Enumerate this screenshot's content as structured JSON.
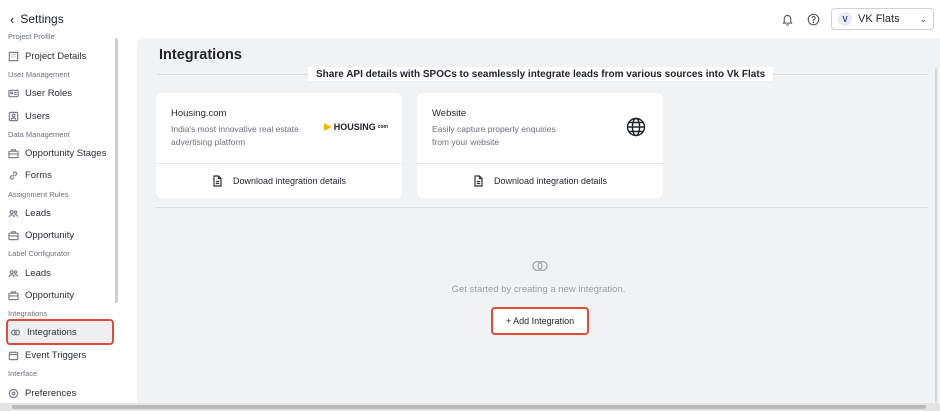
{
  "header": {
    "back_label": "Settings",
    "project_avatar": "V",
    "project_name": "VK Flats"
  },
  "sidebar": {
    "sections": [
      {
        "label": "Project Profile"
      },
      {
        "label": "User Management"
      },
      {
        "label": "Data Management"
      },
      {
        "label": "Assignment Rules"
      },
      {
        "label": "Label Configurator"
      },
      {
        "label": "Integrations"
      },
      {
        "label": "Interface"
      }
    ],
    "items": [
      {
        "label": "Project Details",
        "icon": "building-icon"
      },
      {
        "label": "User Roles",
        "icon": "id-card-icon"
      },
      {
        "label": "Users",
        "icon": "users-icon"
      },
      {
        "label": "Opportunity Stages",
        "icon": "briefcase-icon"
      },
      {
        "label": "Forms",
        "icon": "link-icon"
      },
      {
        "label": "Leads",
        "icon": "people-icon"
      },
      {
        "label": "Opportunity",
        "icon": "briefcase-icon"
      },
      {
        "label": "Leads",
        "icon": "people-icon"
      },
      {
        "label": "Opportunity",
        "icon": "briefcase-icon"
      },
      {
        "label": "Integrations",
        "icon": "integrations-icon",
        "active": true
      },
      {
        "label": "Event Triggers",
        "icon": "calendar-icon"
      },
      {
        "label": "Preferences",
        "icon": "preferences-icon"
      }
    ]
  },
  "main": {
    "title": "Integrations",
    "banner_text": "Share API details with SPOCs to seamlessly integrate leads from various sources into",
    "banner_project": "Vk Flats",
    "cards": [
      {
        "title": "Housing.com",
        "description": "India's most innovative real estate advertising platform",
        "logo_text": "HOUSING",
        "logo_suffix": "com",
        "action_label": "Download integration details"
      },
      {
        "title": "Website",
        "description": "Easily capture property enquiries from your website",
        "logo_icon": "globe-icon",
        "action_label": "Download integration details"
      }
    ],
    "empty_state_text": "Get started by creating a new integration.",
    "add_button_label": "+ Add Integration"
  },
  "colors": {
    "highlight_border": "#e14b3c",
    "main_background": "#f1f2f3",
    "housing_logo_accent": "#f5b800"
  }
}
